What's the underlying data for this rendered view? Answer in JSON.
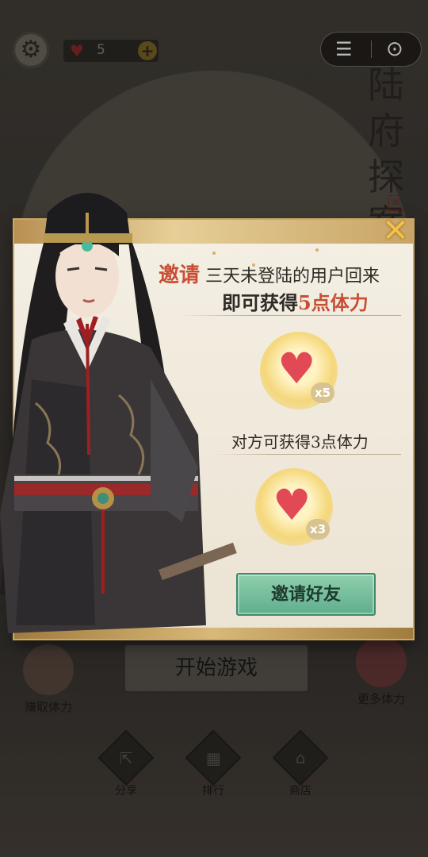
{
  "background": {
    "game_title": "陆府探案",
    "seal": "局"
  },
  "topbar": {
    "hearts_count": "5",
    "plus_label": "+",
    "capsule_menu_icon": "menu-icon",
    "capsule_close_icon": "close-target-icon"
  },
  "home": {
    "start_label": "开始游戏",
    "earn_label": "赚取体力",
    "more_label": "更多体力",
    "nav": [
      {
        "label": "分享",
        "icon": "share-icon"
      },
      {
        "label": "排行",
        "icon": "ranking-icon"
      },
      {
        "label": "商店",
        "icon": "shop-icon"
      }
    ]
  },
  "modal": {
    "line1_highlight": "邀请",
    "line1_rest": "三天未登陆的用户回来",
    "line2_prefix": "即可获得",
    "line2_highlight": "5点体力",
    "reward1_mult": "x5",
    "line3": "对方可获得3点体力",
    "reward2_mult": "x3",
    "invite_label": "邀请好友",
    "close_icon": "close-x-icon"
  },
  "colors": {
    "accent_red": "#c84f34",
    "invite_green": "#6fbd98",
    "gold": "#e6cf97",
    "heart": "#e14a55"
  }
}
